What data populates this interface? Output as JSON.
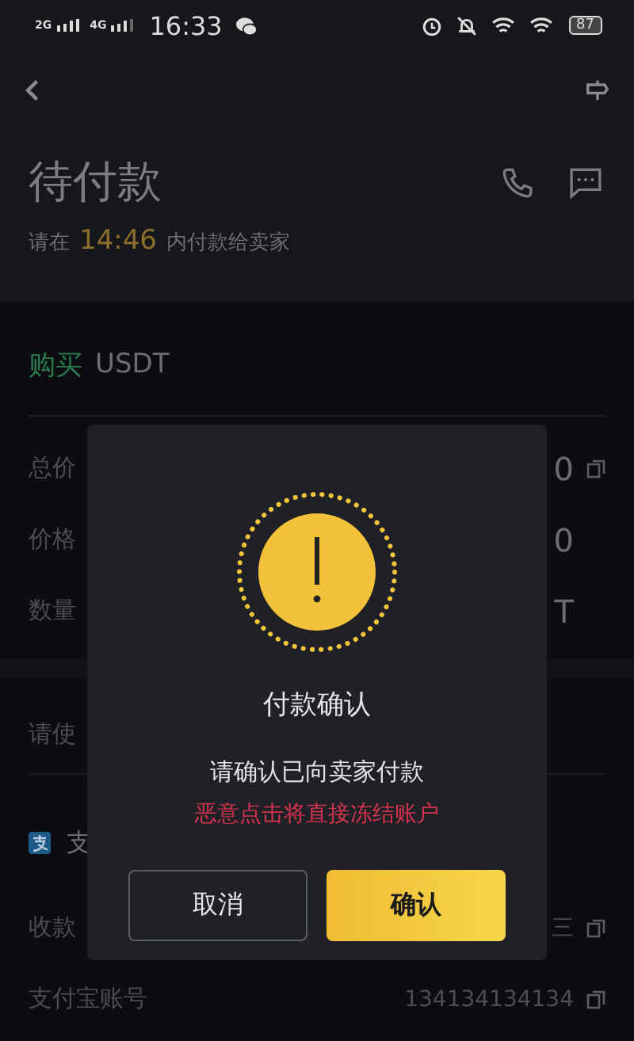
{
  "status_bar": {
    "network_1": "2G",
    "network_2": "4G",
    "time": "16:33",
    "battery": "87"
  },
  "header": {
    "title": "待付款",
    "countdown_prefix": "请在",
    "countdown": "14:46",
    "countdown_suffix": "内付款给卖家"
  },
  "order": {
    "side": "购买",
    "asset": "USDT",
    "rows": [
      {
        "label": "总价",
        "value": "0",
        "copyable": true
      },
      {
        "label": "价格",
        "value": "0",
        "copyable": false
      },
      {
        "label": "数量",
        "value": "T",
        "copyable": false
      }
    ]
  },
  "payment": {
    "hint": "请使",
    "method": "支",
    "rows": [
      {
        "label": "收款",
        "value": "三",
        "copyable": true
      },
      {
        "label": "支付宝账号",
        "value": "134134134134",
        "copyable": true
      }
    ]
  },
  "dialog": {
    "title": "付款确认",
    "message": "请确认已向卖家付款",
    "warning": "恶意点击将直接冻结账户",
    "buttons": [
      {
        "label": "取消",
        "kind": "secondary"
      },
      {
        "label": "确认",
        "kind": "primary"
      }
    ]
  }
}
